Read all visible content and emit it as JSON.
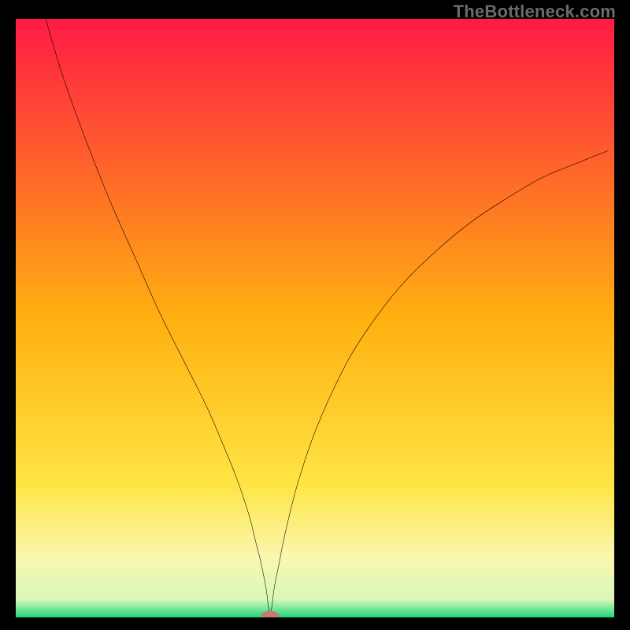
{
  "watermark": "TheBottleneck.com",
  "chart_data": {
    "type": "line",
    "title": "",
    "xlabel": "",
    "ylabel": "",
    "xlim": [
      0,
      100
    ],
    "ylim": [
      0,
      100
    ],
    "grid": false,
    "legend": false,
    "background_gradient": {
      "stops": [
        {
          "offset": 0.0,
          "color": "#ff1a44"
        },
        {
          "offset": 0.5,
          "color": "#ffb010"
        },
        {
          "offset": 0.78,
          "color": "#ffe544"
        },
        {
          "offset": 0.9,
          "color": "#faf7b0"
        },
        {
          "offset": 0.97,
          "color": "#d9f7b8"
        },
        {
          "offset": 1.0,
          "color": "#1fd67a"
        }
      ]
    },
    "marker": {
      "x": 42.5,
      "y": 0,
      "color": "#c77a6f",
      "rx": 1.6,
      "ry": 1.1
    },
    "series": [
      {
        "name": "curve",
        "color": "#000000",
        "x": [
          5,
          8,
          12,
          16,
          20,
          24,
          28,
          32,
          35,
          37,
          39,
          40,
          41,
          41.8,
          42.5,
          43.2,
          44,
          45,
          47,
          50,
          54,
          58,
          64,
          70,
          76,
          82,
          88,
          94,
          99
        ],
        "y": [
          100,
          90,
          79,
          69,
          60,
          51,
          43,
          35,
          28,
          23,
          17,
          13,
          9,
          5,
          0.6,
          5,
          9,
          14,
          22,
          31,
          40,
          47,
          55,
          61,
          66,
          70,
          73.5,
          76,
          78
        ]
      }
    ]
  }
}
